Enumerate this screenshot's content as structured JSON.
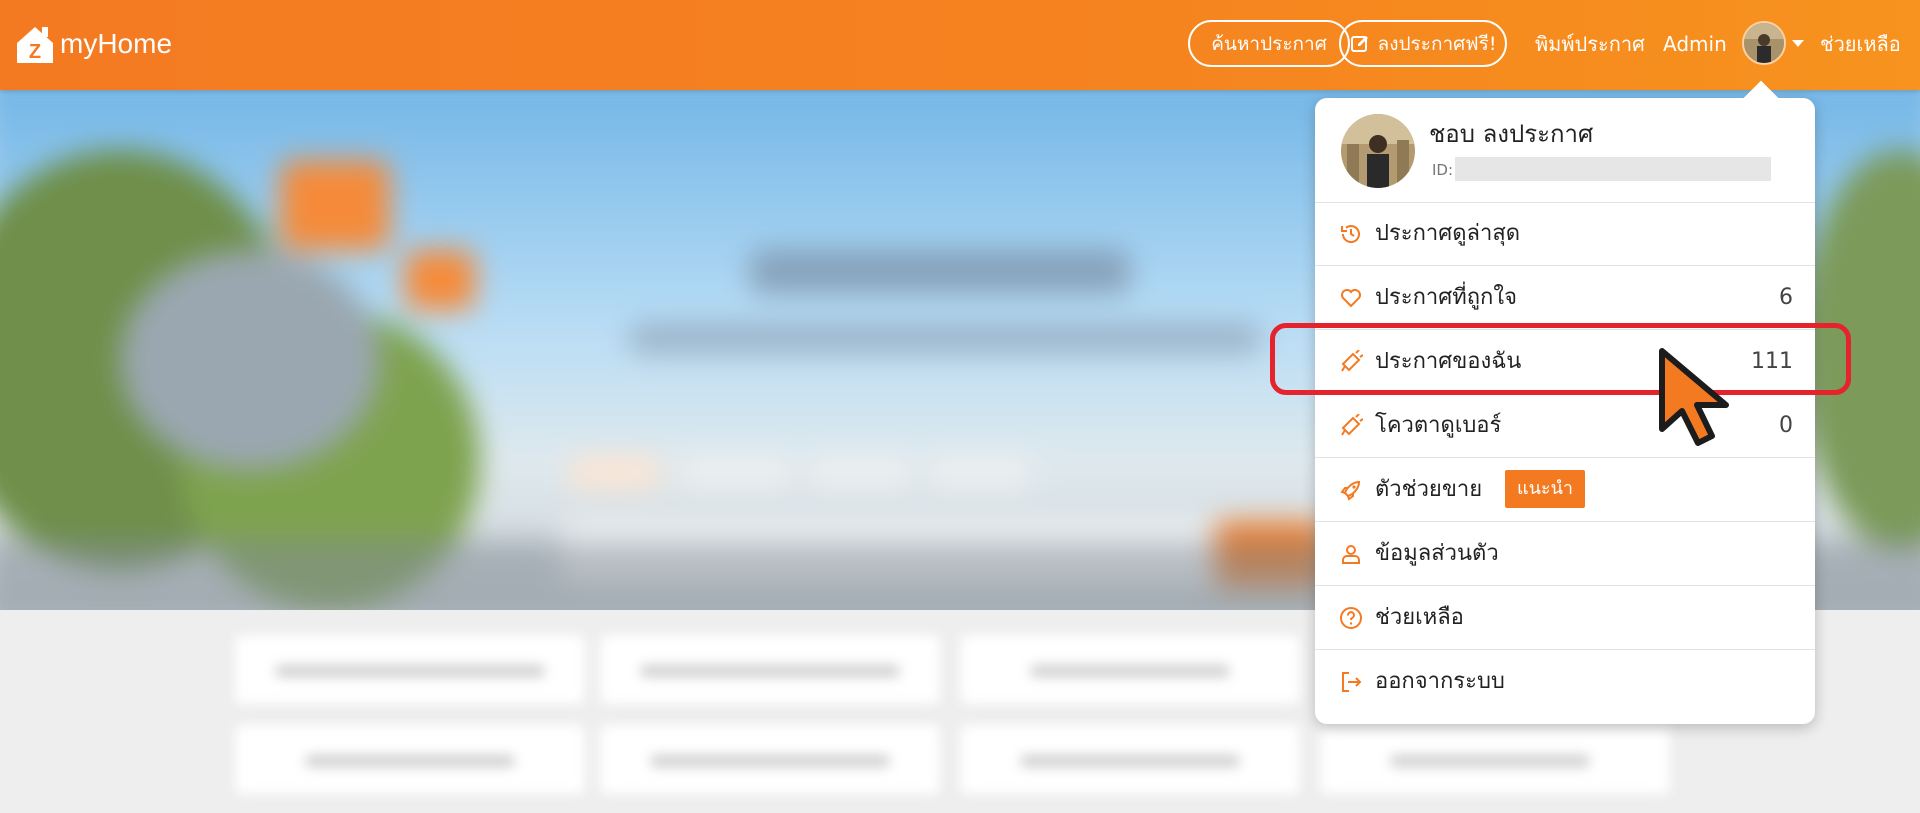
{
  "header": {
    "logo_mark": "Z",
    "logo_text": "myHome",
    "search_button": "ค้นหาประกาศ",
    "post_free_button": "ลงประกาศฟรี!",
    "print_link": "พิมพ์ประกาศ",
    "admin_link": "Admin",
    "help_link": "ช่วยเหลือ"
  },
  "profile": {
    "name": "ชอบ ลงประกาศ",
    "id_label": "ID:"
  },
  "menu": [
    {
      "id": "recent",
      "icon": "history-icon",
      "label": "ประกาศดูล่าสุด",
      "count": ""
    },
    {
      "id": "favorites",
      "icon": "heart-icon",
      "label": "ประกาศที่ถูกใจ",
      "count": "6"
    },
    {
      "id": "my-listings",
      "icon": "megaphone-icon",
      "label": "ประกาศของฉัน",
      "count": "111"
    },
    {
      "id": "booster-quota",
      "icon": "megaphone-icon",
      "label": "โควตาดูเบอร์",
      "count": "0"
    },
    {
      "id": "sales-helper",
      "icon": "rocket-icon",
      "label": "ตัวช่วยขาย",
      "badge": "แนะนำ"
    },
    {
      "id": "profile-info",
      "icon": "user-icon",
      "label": "ข้อมูลส่วนตัว",
      "count": ""
    },
    {
      "id": "help",
      "icon": "question-circle-icon",
      "label": "ช่วยเหลือ",
      "count": ""
    },
    {
      "id": "logout",
      "icon": "logout-icon",
      "label": "ออกจากระบบ",
      "count": ""
    }
  ],
  "colors": {
    "brand_orange": "#f47a22",
    "highlight_red": "#e5232c"
  }
}
